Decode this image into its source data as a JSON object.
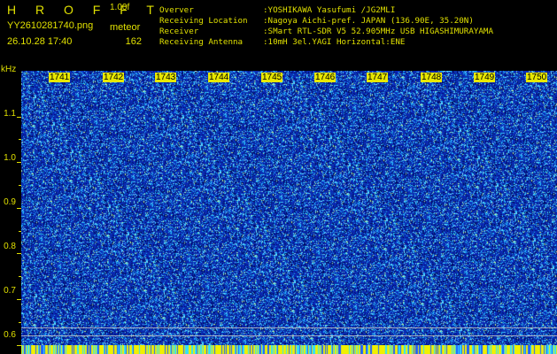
{
  "header": {
    "logo": "H R O F F T",
    "version": "1.00f",
    "file_name": "YY2610281740.png",
    "mode": "meteor",
    "timestamp": "26.10.28 17:40",
    "count": "162"
  },
  "station_info": [
    {
      "label": "Overver",
      "value": ":YOSHIKAWA Yasufumi /JG2MLI"
    },
    {
      "label": "Receiving Location",
      "value": ":Nagoya Aichi-pref. JAPAN (136.90E, 35.20N)"
    },
    {
      "label": "Receiver",
      "value": ":SMart RTL-SDR V5 52.905MHz USB HIGASHIMURAYAMA"
    },
    {
      "label": "Receiving Antenna",
      "value": ":10mH 3el.YAGI Horizontal:ENE"
    }
  ],
  "axis": {
    "unit": "kHz",
    "ticks": [
      "1.1",
      "1.0",
      "0.9",
      "0.8",
      "0.7",
      "0.6"
    ],
    "tick_values": [
      1.1,
      1.0,
      0.9,
      0.8,
      0.7,
      0.6
    ],
    "range": [
      0.58,
      1.2
    ]
  },
  "time_labels": [
    "1741",
    "1742",
    "1743",
    "1744",
    "1745",
    "1746",
    "1747",
    "1748",
    "1749",
    "1750"
  ],
  "colors": {
    "background": "#000000",
    "text": "#e0e000",
    "waterfall_base": "#0a1fa8",
    "noise_light": "#39c6ff",
    "noise_dark": "#000a60",
    "strip_yellow": "#f0f000",
    "strip_cyan": "#30e0ff"
  }
}
